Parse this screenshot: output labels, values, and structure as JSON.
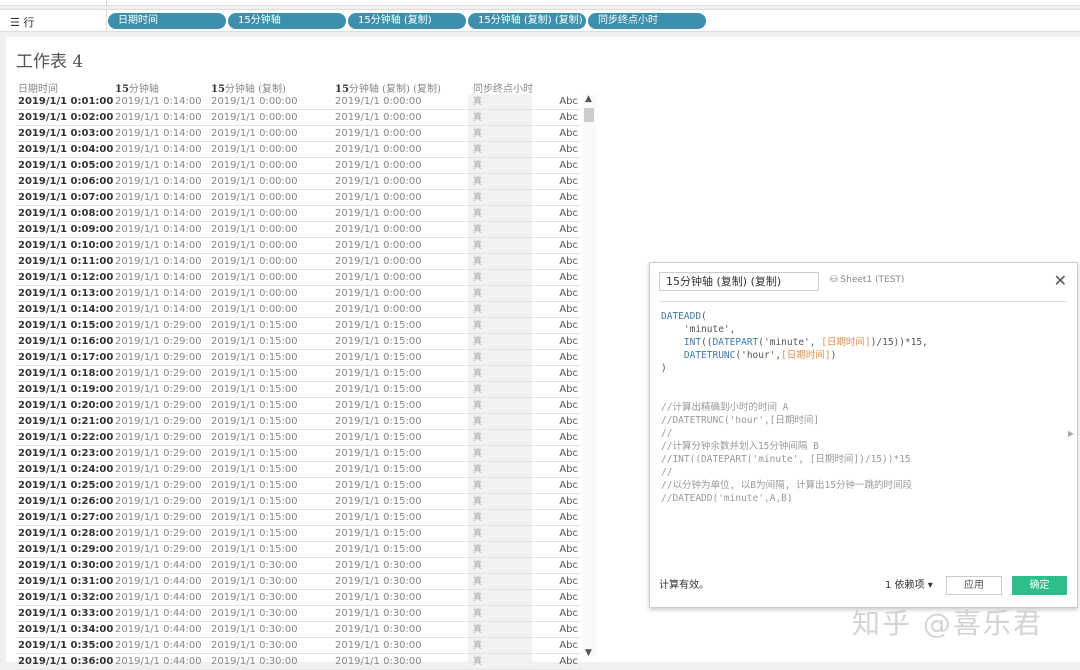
{
  "shelf": {
    "label": "行",
    "icon": "list-icon",
    "pills": [
      "日期时间",
      "15分钟轴",
      "15分钟轴 (复制)",
      "15分钟轴 (复制) (复制)",
      "同步终点小时"
    ]
  },
  "sheet": {
    "title": "工作表 4",
    "headers": [
      {
        "bold": "",
        "rest": "日期时间"
      },
      {
        "bold": "15",
        "rest": "分钟轴"
      },
      {
        "bold": "15",
        "rest": "分钟轴 (复制)"
      },
      {
        "bold": "15",
        "rest": "分钟轴 (复制) (复制)"
      },
      {
        "bold": "",
        "rest": "同步终点小时"
      }
    ],
    "rows": [
      [
        "2019/1/1 0:01:00",
        "2019/1/1 0:14:00",
        "2019/1/1 0:00:00",
        "2019/1/1 0:00:00",
        "真",
        "Abc"
      ],
      [
        "2019/1/1 0:02:00",
        "2019/1/1 0:14:00",
        "2019/1/1 0:00:00",
        "2019/1/1 0:00:00",
        "真",
        "Abc"
      ],
      [
        "2019/1/1 0:03:00",
        "2019/1/1 0:14:00",
        "2019/1/1 0:00:00",
        "2019/1/1 0:00:00",
        "真",
        "Abc"
      ],
      [
        "2019/1/1 0:04:00",
        "2019/1/1 0:14:00",
        "2019/1/1 0:00:00",
        "2019/1/1 0:00:00",
        "真",
        "Abc"
      ],
      [
        "2019/1/1 0:05:00",
        "2019/1/1 0:14:00",
        "2019/1/1 0:00:00",
        "2019/1/1 0:00:00",
        "真",
        "Abc"
      ],
      [
        "2019/1/1 0:06:00",
        "2019/1/1 0:14:00",
        "2019/1/1 0:00:00",
        "2019/1/1 0:00:00",
        "真",
        "Abc"
      ],
      [
        "2019/1/1 0:07:00",
        "2019/1/1 0:14:00",
        "2019/1/1 0:00:00",
        "2019/1/1 0:00:00",
        "真",
        "Abc"
      ],
      [
        "2019/1/1 0:08:00",
        "2019/1/1 0:14:00",
        "2019/1/1 0:00:00",
        "2019/1/1 0:00:00",
        "真",
        "Abc"
      ],
      [
        "2019/1/1 0:09:00",
        "2019/1/1 0:14:00",
        "2019/1/1 0:00:00",
        "2019/1/1 0:00:00",
        "真",
        "Abc"
      ],
      [
        "2019/1/1 0:10:00",
        "2019/1/1 0:14:00",
        "2019/1/1 0:00:00",
        "2019/1/1 0:00:00",
        "真",
        "Abc"
      ],
      [
        "2019/1/1 0:11:00",
        "2019/1/1 0:14:00",
        "2019/1/1 0:00:00",
        "2019/1/1 0:00:00",
        "真",
        "Abc"
      ],
      [
        "2019/1/1 0:12:00",
        "2019/1/1 0:14:00",
        "2019/1/1 0:00:00",
        "2019/1/1 0:00:00",
        "真",
        "Abc"
      ],
      [
        "2019/1/1 0:13:00",
        "2019/1/1 0:14:00",
        "2019/1/1 0:00:00",
        "2019/1/1 0:00:00",
        "真",
        "Abc"
      ],
      [
        "2019/1/1 0:14:00",
        "2019/1/1 0:14:00",
        "2019/1/1 0:00:00",
        "2019/1/1 0:00:00",
        "真",
        "Abc"
      ],
      [
        "2019/1/1 0:15:00",
        "2019/1/1 0:29:00",
        "2019/1/1 0:15:00",
        "2019/1/1 0:15:00",
        "真",
        "Abc"
      ],
      [
        "2019/1/1 0:16:00",
        "2019/1/1 0:29:00",
        "2019/1/1 0:15:00",
        "2019/1/1 0:15:00",
        "真",
        "Abc"
      ],
      [
        "2019/1/1 0:17:00",
        "2019/1/1 0:29:00",
        "2019/1/1 0:15:00",
        "2019/1/1 0:15:00",
        "真",
        "Abc"
      ],
      [
        "2019/1/1 0:18:00",
        "2019/1/1 0:29:00",
        "2019/1/1 0:15:00",
        "2019/1/1 0:15:00",
        "真",
        "Abc"
      ],
      [
        "2019/1/1 0:19:00",
        "2019/1/1 0:29:00",
        "2019/1/1 0:15:00",
        "2019/1/1 0:15:00",
        "真",
        "Abc"
      ],
      [
        "2019/1/1 0:20:00",
        "2019/1/1 0:29:00",
        "2019/1/1 0:15:00",
        "2019/1/1 0:15:00",
        "真",
        "Abc"
      ],
      [
        "2019/1/1 0:21:00",
        "2019/1/1 0:29:00",
        "2019/1/1 0:15:00",
        "2019/1/1 0:15:00",
        "真",
        "Abc"
      ],
      [
        "2019/1/1 0:22:00",
        "2019/1/1 0:29:00",
        "2019/1/1 0:15:00",
        "2019/1/1 0:15:00",
        "真",
        "Abc"
      ],
      [
        "2019/1/1 0:23:00",
        "2019/1/1 0:29:00",
        "2019/1/1 0:15:00",
        "2019/1/1 0:15:00",
        "真",
        "Abc"
      ],
      [
        "2019/1/1 0:24:00",
        "2019/1/1 0:29:00",
        "2019/1/1 0:15:00",
        "2019/1/1 0:15:00",
        "真",
        "Abc"
      ],
      [
        "2019/1/1 0:25:00",
        "2019/1/1 0:29:00",
        "2019/1/1 0:15:00",
        "2019/1/1 0:15:00",
        "真",
        "Abc"
      ],
      [
        "2019/1/1 0:26:00",
        "2019/1/1 0:29:00",
        "2019/1/1 0:15:00",
        "2019/1/1 0:15:00",
        "真",
        "Abc"
      ],
      [
        "2019/1/1 0:27:00",
        "2019/1/1 0:29:00",
        "2019/1/1 0:15:00",
        "2019/1/1 0:15:00",
        "真",
        "Abc"
      ],
      [
        "2019/1/1 0:28:00",
        "2019/1/1 0:29:00",
        "2019/1/1 0:15:00",
        "2019/1/1 0:15:00",
        "真",
        "Abc"
      ],
      [
        "2019/1/1 0:29:00",
        "2019/1/1 0:29:00",
        "2019/1/1 0:15:00",
        "2019/1/1 0:15:00",
        "真",
        "Abc"
      ],
      [
        "2019/1/1 0:30:00",
        "2019/1/1 0:44:00",
        "2019/1/1 0:30:00",
        "2019/1/1 0:30:00",
        "真",
        "Abc"
      ],
      [
        "2019/1/1 0:31:00",
        "2019/1/1 0:44:00",
        "2019/1/1 0:30:00",
        "2019/1/1 0:30:00",
        "真",
        "Abc"
      ],
      [
        "2019/1/1 0:32:00",
        "2019/1/1 0:44:00",
        "2019/1/1 0:30:00",
        "2019/1/1 0:30:00",
        "真",
        "Abc"
      ],
      [
        "2019/1/1 0:33:00",
        "2019/1/1 0:44:00",
        "2019/1/1 0:30:00",
        "2019/1/1 0:30:00",
        "真",
        "Abc"
      ],
      [
        "2019/1/1 0:34:00",
        "2019/1/1 0:44:00",
        "2019/1/1 0:30:00",
        "2019/1/1 0:30:00",
        "真",
        "Abc"
      ],
      [
        "2019/1/1 0:35:00",
        "2019/1/1 0:44:00",
        "2019/1/1 0:30:00",
        "2019/1/1 0:30:00",
        "真",
        "Abc"
      ],
      [
        "2019/1/1 0:36:00",
        "2019/1/1 0:44:00",
        "2019/1/1 0:30:00",
        "2019/1/1 0:30:00",
        "真",
        "Abc"
      ]
    ]
  },
  "dialog": {
    "name": "15分钟轴 (复制) (复制)",
    "source": "Sheet1 (TEST)",
    "close": "✕",
    "code": [
      [
        [
          "fn",
          "DATEADD"
        ],
        [
          "",
          "("
        ]
      ],
      [
        [
          "",
          "    'minute',"
        ]
      ],
      [
        [
          "",
          "    "
        ],
        [
          "fn",
          "INT"
        ],
        [
          "",
          "(("
        ],
        [
          "fn",
          "DATEPART"
        ],
        [
          "",
          "('minute', "
        ],
        [
          "fld",
          "[日期时间]"
        ],
        [
          "",
          ")/15))*15,"
        ]
      ],
      [
        [
          "",
          "    "
        ],
        [
          "fn",
          "DATETRUNC"
        ],
        [
          "",
          "('hour',"
        ],
        [
          "fld",
          "[日期时间]"
        ],
        [
          "",
          ")"
        ]
      ],
      [
        [
          "",
          ")"
        ]
      ],
      [
        [
          "",
          ""
        ]
      ],
      [
        [
          "",
          ""
        ]
      ],
      [
        [
          "cm",
          "//计算出精确到小时的时间 A"
        ]
      ],
      [
        [
          "cm",
          "//DATETRUNC('hour',[日期时间]"
        ]
      ],
      [
        [
          "cm",
          "//"
        ]
      ],
      [
        [
          "cm",
          "//计算分钟余数并划入15分钟间隔 B"
        ]
      ],
      [
        [
          "cm",
          "//INT((DATEPART('minute', [日期时间])/15))*15"
        ]
      ],
      [
        [
          "cm",
          "//"
        ]
      ],
      [
        [
          "cm",
          "//以分钟为单位, 以B为间隔, 计算出15分钟一跳的时间段"
        ]
      ],
      [
        [
          "cm",
          "//DATEADD('minute',A,B)"
        ]
      ]
    ],
    "status": "计算有效。",
    "deps": "1 依赖项 ▾",
    "apply": "应用",
    "ok": "确定"
  },
  "watermark": "知乎 @喜乐君",
  "colors": {
    "pill": "#3c8fad",
    "ok": "#2dbf8a",
    "function": "#3a7bb0",
    "field": "#e0914a"
  }
}
